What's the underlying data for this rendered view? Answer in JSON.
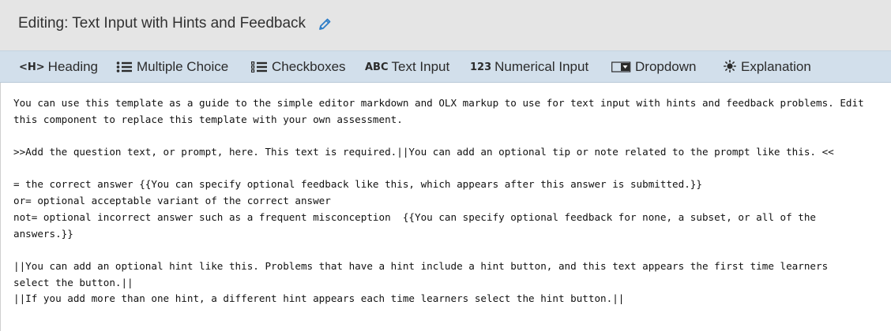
{
  "header": {
    "title": "Editing: Text Input with Hints and Feedback",
    "edit_icon": "pencil-icon"
  },
  "toolbar": {
    "items": [
      {
        "icon_text": "<H>",
        "label": "Heading",
        "icon": "heading-icon"
      },
      {
        "icon_text": "",
        "label": "Multiple Choice",
        "icon": "multiple-choice-icon"
      },
      {
        "icon_text": "",
        "label": "Checkboxes",
        "icon": "checkboxes-icon"
      },
      {
        "icon_text": "ABC",
        "label": "Text Input",
        "icon": "text-input-icon"
      },
      {
        "icon_text": "123",
        "label": "Numerical Input",
        "icon": "numerical-input-icon"
      },
      {
        "icon_text": "",
        "label": "Dropdown",
        "icon": "dropdown-icon"
      },
      {
        "icon_text": "",
        "label": "Explanation",
        "icon": "explanation-icon"
      }
    ]
  },
  "editor": {
    "lines": [
      "You can use this template as a guide to the simple editor markdown and OLX markup to use for text input with hints and feedback problems. Edit",
      "this component to replace this template with your own assessment.",
      "",
      ">>Add the question text, or prompt, here. This text is required.||You can add an optional tip or note related to the prompt like this. <<",
      "",
      "= the correct answer {{You can specify optional feedback like this, which appears after this answer is submitted.}}",
      "or= optional acceptable variant of the correct answer",
      "not= optional incorrect answer such as a frequent misconception  {{You can specify optional feedback for none, a subset, or all of the",
      "answers.}}",
      "",
      "||You can add an optional hint like this. Problems that have a hint include a hint button, and this text appears the first time learners",
      "select the button.||",
      "||If you add more than one hint, a different hint appears each time learners select the hint button.||"
    ]
  },
  "colors": {
    "title_bar_bg": "#e5e5e5",
    "toolbar_bg": "#d2dfeb",
    "pencil_blue": "#2f7ec8"
  }
}
